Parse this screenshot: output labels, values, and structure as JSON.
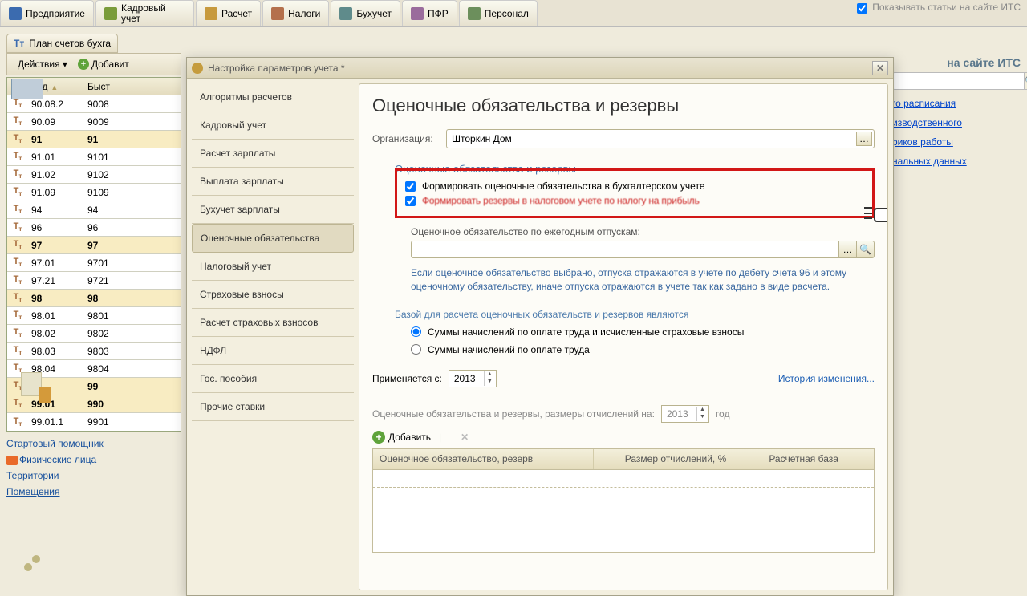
{
  "top_tabs": [
    "Предприятие",
    "Кадровый учет",
    "Расчет",
    "Налоги",
    "Бухучет",
    "ПФР",
    "Персонал"
  ],
  "its_toggle": "Показывать статьи на сайте ИТС",
  "its_header": "на сайте ИТС",
  "right_links": [
    "го расписания",
    "изводственного",
    "риков работы",
    "нальных данных"
  ],
  "plan_tab": "План счетов бухга",
  "actions_label": "Действия ▾",
  "add_label": "Добавит",
  "grid": {
    "headers": [
      "",
      "Код",
      "Быст"
    ],
    "rows": [
      {
        "code": "90.08.2",
        "b": "9008",
        "bold": false
      },
      {
        "code": "90.09",
        "b": "9009",
        "bold": false
      },
      {
        "code": "91",
        "b": "91",
        "bold": true,
        "hl": true
      },
      {
        "code": "91.01",
        "b": "9101",
        "bold": false
      },
      {
        "code": "91.02",
        "b": "9102",
        "bold": false
      },
      {
        "code": "91.09",
        "b": "9109",
        "bold": false
      },
      {
        "code": "94",
        "b": "94",
        "bold": false
      },
      {
        "code": "96",
        "b": "96",
        "bold": false
      },
      {
        "code": "97",
        "b": "97",
        "bold": true,
        "hl": true
      },
      {
        "code": "97.01",
        "b": "9701",
        "bold": false
      },
      {
        "code": "97.21",
        "b": "9721",
        "bold": false
      },
      {
        "code": "98",
        "b": "98",
        "bold": true,
        "hl": true
      },
      {
        "code": "98.01",
        "b": "9801",
        "bold": false
      },
      {
        "code": "98.02",
        "b": "9802",
        "bold": false
      },
      {
        "code": "98.03",
        "b": "9803",
        "bold": false
      },
      {
        "code": "98.04",
        "b": "9804",
        "bold": false
      },
      {
        "code": "99",
        "b": "99",
        "bold": true,
        "hl": true
      },
      {
        "code": "99.01",
        "b": "990",
        "bold": true,
        "hl": true
      },
      {
        "code": "99.01.1",
        "b": "9901",
        "bold": false
      }
    ]
  },
  "bottom_links": [
    "Стартовый помощник",
    "Физические лица",
    "Территории",
    "Помещения"
  ],
  "modal": {
    "title": "Настройка параметров учета *",
    "sidenav": [
      "Алгоритмы расчетов",
      "Кадровый учет",
      "Расчет зарплаты",
      "Выплата зарплаты",
      "Бухучет зарплаты",
      "Оценочные обязательства",
      "Налоговый учет",
      "Страховые взносы",
      "Расчет страховых взносов",
      "НДФЛ",
      "Гос. пособия",
      "Прочие ставки"
    ],
    "selected_index": 5,
    "heading": "Оценочные обязательства и резервы",
    "org_label": "Организация:",
    "org_value": "Шторкин Дом",
    "group1": "Оценочные обязательства и резервы",
    "checkbox1": "Формировать оценочные обязательства в бухгалтерском учете",
    "checkbox2": "Формировать резервы в налоговом учете по налогу на прибыль",
    "sub1": "Оценочное обязательство по ежегодным отпускам:",
    "info": "Если оценочное обязательство выбрано, отпуска отражаются в учете по дебету счета 96 и этому оценочному обязательству, иначе отпуска отражаются в учете так как задано в виде расчета.",
    "base_hdr": "Базой для расчета оценочных обязательств и резервов являются",
    "radio1": "Суммы начислений по оплате труда и исчисленные страховые взносы",
    "radio2": "Суммы начислений по оплате труда",
    "applied_label": "Применяется с:",
    "applied_year": "2013",
    "history": "История изменения...",
    "sizes_label": "Оценочные обязательства и резервы, размеры отчислений на:",
    "sizes_year": "2013",
    "sizes_suffix": "год",
    "add2": "Добавить",
    "table_headers": [
      "Оценочное обязательство, резерв",
      "Размер отчислений, %",
      "Расчетная база"
    ]
  }
}
